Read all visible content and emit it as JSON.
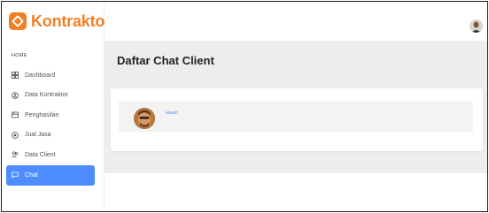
{
  "brand": {
    "name": "Kontraktor",
    "color": "#f07f25"
  },
  "sidebar": {
    "section_label": "HOME",
    "items": [
      {
        "label": "Dashboard",
        "icon": "dashboard-icon",
        "active": false
      },
      {
        "label": "Data Kontraktor",
        "icon": "contractor-icon",
        "active": false
      },
      {
        "label": "Penghasilan",
        "icon": "income-icon",
        "active": false
      },
      {
        "label": "Jual Jasa",
        "icon": "service-icon",
        "active": false
      },
      {
        "label": "Data Client",
        "icon": "users-icon",
        "active": false
      },
      {
        "label": "Chat",
        "icon": "chat-icon",
        "active": true
      }
    ],
    "active_color": "#4e8dff"
  },
  "header": {
    "user_avatar": "user-avatar"
  },
  "main": {
    "title": "Daftar Chat Client",
    "chats": [
      {
        "name": "arwah"
      }
    ]
  }
}
